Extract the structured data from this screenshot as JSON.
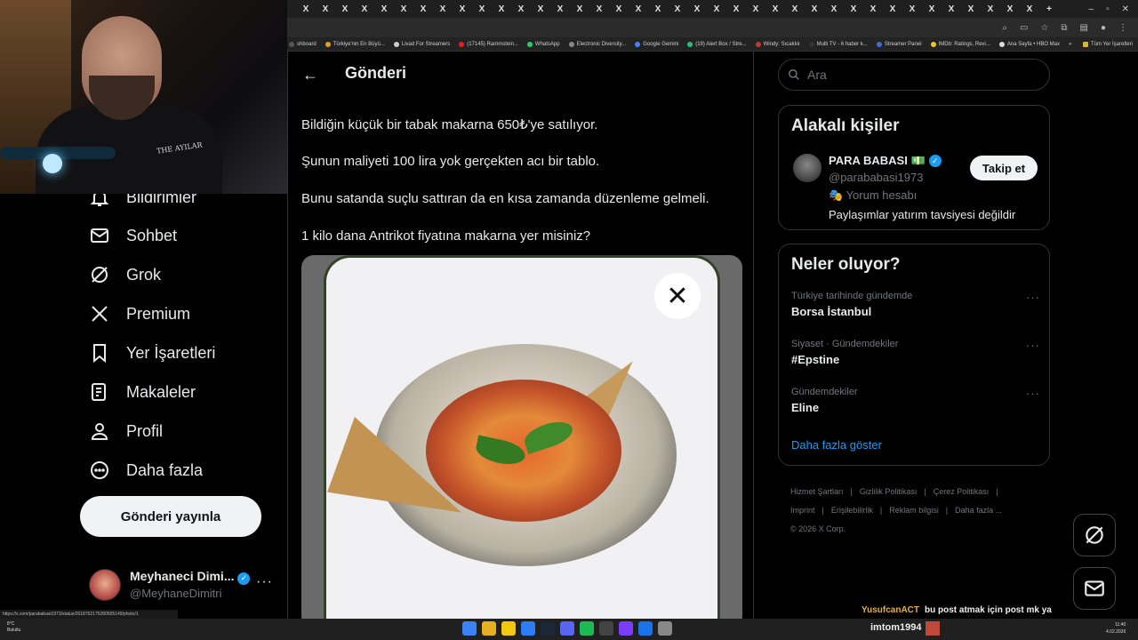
{
  "browser": {
    "tab_close_glyph": "X",
    "bookmarks": [
      {
        "label": "shboard",
        "color": "#555"
      },
      {
        "label": "Türkiye'nin En Büyü...",
        "color": "#e0a020"
      },
      {
        "label": "Livad For Streamers",
        "color": "#ccc"
      },
      {
        "label": "(17145) Rammstein...",
        "color": "#e02020"
      },
      {
        "label": "WhatsApp",
        "color": "#25d366"
      },
      {
        "label": "Electronic Diversity...",
        "color": "#888"
      },
      {
        "label": "Google Gemini",
        "color": "#4285f4"
      },
      {
        "label": "(19) Alert Box / Stre...",
        "color": "#2bbf7a"
      },
      {
        "label": "Windy: Sıcaklık",
        "color": "#c0392b"
      },
      {
        "label": "Multi TV - 6 haber k...",
        "color": "#333"
      },
      {
        "label": "Streamer Panel",
        "color": "#3a6fd8"
      },
      {
        "label": "IMDb: Ratings, Revi...",
        "color": "#f5c518"
      },
      {
        "label": "Ana Sayfa • HBO Max",
        "color": "#ddd"
      }
    ],
    "bookmarks_more": "»",
    "all_bookmarks": "Tüm Yer İşaretleri",
    "status_url": "https://x.com/parababasi1973/status/2018762175280505149/photo/1"
  },
  "nav": {
    "items": [
      {
        "label": "Bildirimler",
        "icon": "bell-icon"
      },
      {
        "label": "Sohbet",
        "icon": "mail-icon"
      },
      {
        "label": "Grok",
        "icon": "grok-icon"
      },
      {
        "label": "Premium",
        "icon": "x-logo-icon"
      },
      {
        "label": "Yer İşaretleri",
        "icon": "bookmark-icon"
      },
      {
        "label": "Makaleler",
        "icon": "article-icon"
      },
      {
        "label": "Profil",
        "icon": "person-icon"
      },
      {
        "label": "Daha fazla",
        "icon": "more-circle-icon"
      }
    ],
    "post_button": "Gönderi yayınla",
    "account": {
      "name": "Meyhaneci Dimi...",
      "handle": "@MeyhaneDimitri",
      "more": "···"
    }
  },
  "main": {
    "back_glyph": "←",
    "title": "Gönderi",
    "paragraphs": [
      "Bildiğin küçük bir tabak makarna 650₺'ye satılıyor.",
      "Şunun maliyeti 100 lira yok gerçekten acı bir tablo.",
      "Bunu satanda suçlu sattıran da en kısa zamanda düzenleme gelmeli.",
      "1 kilo dana Antrikot fiyatına makarna yer misiniz?"
    ],
    "media_close_glyph": "✕"
  },
  "right": {
    "search_placeholder": "Ara",
    "related": {
      "heading": "Alakalı kişiler",
      "name": "PARA BABASI 💵",
      "handle": "@parababasi1973",
      "note": "🎭 Yorum hesabı",
      "bio": "Paylaşımlar yatırım tavsiyesi değildir",
      "follow": "Takip et"
    },
    "trends": {
      "heading": "Neler oluyor?",
      "items": [
        {
          "meta": "Türkiye tarihinde gündemde",
          "topic": "Borsa İstanbul"
        },
        {
          "meta": "Siyaset · Gündemdekiler",
          "topic": "#Epstine"
        },
        {
          "meta": "Gündemdekiler",
          "topic": "Eline"
        }
      ],
      "more_glyph": "···",
      "show_more": "Daha fazla göster"
    },
    "footer": {
      "links": [
        "Hizmet Şartları",
        "Gizlilik Politikası",
        "Çerez Politikası",
        "Imprint",
        "Erişilebilirlik",
        "Reklam bilgisi",
        "Daha fazla ..."
      ],
      "separator": "|",
      "copyright": "© 2026 X Corp."
    }
  },
  "chat": {
    "user": "YusufcanACT",
    "message": "bu post atmak için post mk ya"
  },
  "taskbar": {
    "weather_temp": "8°C",
    "weather_desc": "Bulutlu",
    "streamer": "imtom1994",
    "time": "11:40",
    "date": "4.02.2026",
    "app_colors": [
      "#3b82f6",
      "#e8b020",
      "#f2c811",
      "#2d7df6",
      "#1b2838",
      "#5865f2",
      "#1db954",
      "#444",
      "#7a3cff",
      "#1a73e8",
      "#888"
    ]
  },
  "webcam": {
    "logo_text": "THE AYILAR"
  }
}
